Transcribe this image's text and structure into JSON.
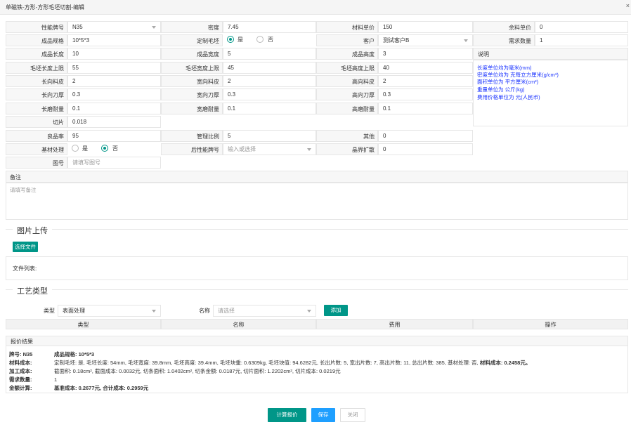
{
  "window": {
    "title": "单磁铁-方形-方形毛坯切割-编辑",
    "close": "×"
  },
  "form": {
    "row1": {
      "grade_label": "性能牌号",
      "grade_value": "N35",
      "density_label": "密度",
      "density_value": "7.45",
      "material_price_label": "材料单价",
      "material_price_value": "150",
      "scrap_price_label": "余料单价",
      "scrap_price_value": "0"
    },
    "row2": {
      "spec_label": "成品规格",
      "spec_value": "10*5*3",
      "custom_blank_label": "定制毛坯",
      "yes": "是",
      "no": "否",
      "customer_label": "客户",
      "customer_value": "测试客户B",
      "qty_label": "需求数量",
      "qty_value": "1"
    },
    "row3": {
      "len_label": "成品长度",
      "len_value": "10",
      "wid_label": "成品宽度",
      "wid_value": "5",
      "hei_label": "成品高度",
      "hei_value": "3",
      "notes_label": "说明"
    },
    "row4": {
      "blank_len_label": "毛坯长度上限",
      "blank_len_value": "55",
      "blank_wid_label": "毛坯宽度上限",
      "blank_wid_value": "45",
      "blank_hei_label": "毛坯高度上限",
      "blank_hei_value": "40"
    },
    "row5": {
      "len_skin_label": "长向料皮",
      "len_skin_value": "2",
      "wid_skin_label": "宽向料皮",
      "wid_skin_value": "2",
      "hei_skin_label": "高向料皮",
      "hei_skin_value": "2"
    },
    "row6": {
      "len_blade_label": "长向刀厚",
      "len_blade_value": "0.3",
      "wid_blade_label": "宽向刀厚",
      "wid_blade_value": "0.3",
      "hei_blade_label": "高向刀厚",
      "hei_blade_value": "0.3"
    },
    "row7": {
      "len_grind_label": "长磨耐量",
      "len_grind_value": "0.1",
      "wid_grind_label": "宽磨耐量",
      "wid_grind_value": "0.1",
      "hei_grind_label": "高磨耐量",
      "hei_grind_value": "0.1"
    },
    "row8": {
      "slice_label": "切片",
      "slice_value": "0.018"
    },
    "row9": {
      "yield_label": "良品率",
      "yield_value": "95",
      "mgmt_label": "管理比例",
      "mgmt_value": "5",
      "other_label": "其他",
      "other_value": "0"
    },
    "row10": {
      "base_label": "基材处理",
      "yes": "是",
      "no": "否",
      "post_grade_label": "后性能牌号",
      "post_grade_placeholder": "输入或选择",
      "grain_label": "晶界扩散",
      "grain_value": "0"
    },
    "row11": {
      "drawing_label": "图号",
      "drawing_placeholder": "请填写图号"
    },
    "notes_lines": [
      "长度单位均为毫米(mm)",
      "密度单位均为 克每立方厘米(g/cm³)",
      "面积单位为 平方厘米(cm²)",
      "重量单位为 公斤(kg)",
      "费用价格单位为 元(人民币)"
    ],
    "remark_label": "备注",
    "remark_placeholder": "请填写备注"
  },
  "upload": {
    "title": "图片上传",
    "choose_button": "选择文件",
    "file_list_label": "文件列表:"
  },
  "process": {
    "title": "工艺类型",
    "type_label": "类型",
    "type_value": "表面处理",
    "name_label": "名称",
    "name_placeholder": "请选择",
    "add_button": "添加",
    "columns": [
      "类型",
      "名称",
      "费用",
      "操作"
    ]
  },
  "result": {
    "header": "报价结果",
    "grade": "牌号: N35",
    "spec": "成品规格: 10*5*3",
    "material_key": "材料成本:",
    "material_text": "定制毛坯: 是, 毛坯长度: 54mm, 毛坯宽度: 39.8mm, 毛坯高度: 39.4mm, 毛坯块重: 0.6309kg, 毛坯块值: 94.6282元, 长出片数: 5, 宽出片数: 7, 高出片数: 11, 总出片数: 385, 基材处理: 否,",
    "material_bold": "材料成本: 0.2458元。",
    "processing_key": "加工成本:",
    "processing_text": "截面积: 0.18cm², 截面成本: 0.0032元, 切条面积: 1.0402cm², 切条金额: 0.0187元, 切片面积: 1.2202cm², 切片成本: 0.0219元",
    "qty_key": "需求数量:",
    "qty_value": "1",
    "amount_key": "金额计算:",
    "amount_value": "基准成本: 0.2677元, 合计成本: 0.2959元"
  },
  "footer": {
    "calc_button": "计算报价",
    "save_button": "保存",
    "close_button": "关闭"
  },
  "colors": {
    "accent": "#009688",
    "primary": "#1e9fff",
    "notes_text": "#1a33ff"
  }
}
